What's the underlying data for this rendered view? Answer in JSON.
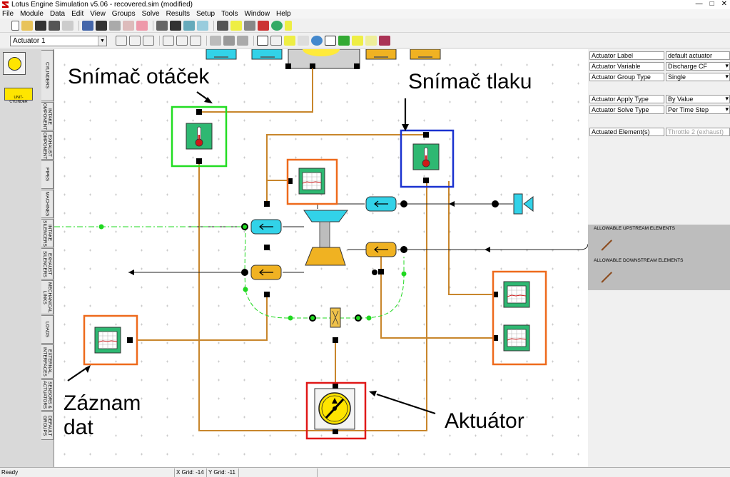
{
  "window": {
    "title": "Lotus Engine Simulation v5.06 - recovered.sim (modified)",
    "controls": [
      "—",
      "□",
      "✕"
    ]
  },
  "menu": [
    "File",
    "Module",
    "Data",
    "Edit",
    "View",
    "Groups",
    "Solve",
    "Results",
    "Setup",
    "Tools",
    "Window",
    "Help"
  ],
  "toolbar": {
    "element_select": "Actuator 1"
  },
  "left_panel": {
    "unit_cylinder_label": "UNIT-CYLINDER",
    "tabs": [
      "CYLINDERS",
      "INTAKE\nCOMPONENTS",
      "EXHAUST\nCOMPONENTS",
      "PIPES",
      "MACHINES",
      "INTAKE\nSILENCERS",
      "EXHAUST\nSILENCERS",
      "MECHANICAL\nLINKS",
      "LOADS",
      "EXTERNAL\nINTERFACES",
      "SENSORS &\nACTUATORS",
      "DEFAULT\nGROUPS"
    ]
  },
  "annotations": {
    "speed_sensor": "Snímač otáček",
    "pressure_sensor": "Snímač tlaku",
    "data_record_line1": "Záznam",
    "data_record_line2": "dat",
    "actuator": "Aktuátor"
  },
  "properties": {
    "rows": [
      {
        "label": "Actuator Label",
        "value": "default actuator",
        "dropdown": false,
        "disabled": false
      },
      {
        "label": "Actuator Variable",
        "value": "Discharge CF",
        "dropdown": true,
        "disabled": false
      },
      {
        "label": "Actuator Group Type",
        "value": "Single",
        "dropdown": true,
        "disabled": false
      },
      {
        "label": "Actuator Apply Type",
        "value": "By Value",
        "dropdown": true,
        "disabled": false
      },
      {
        "label": "Actuator Solve Type",
        "value": "Per Time Step",
        "dropdown": true,
        "disabled": false
      },
      {
        "label": "Actuated Element(s)",
        "value": "Throttle 2 (exhaust)",
        "dropdown": false,
        "disabled": true
      }
    ],
    "allowable_upstream": "ALLOWABLE UPSTREAM ELEMENTS",
    "allowable_downstream": "ALLOWABLE DOWNSTREAM ELEMENTS"
  },
  "status": {
    "state": "Ready",
    "x_grid": "X Grid: -14",
    "y_grid": "Y Grid: -11"
  },
  "colors": {
    "pipe_orange": "#c8862c",
    "signal_green": "#20d820",
    "sensor_green": "#2eb872",
    "box_green": "#22dd22",
    "box_blue": "#1a32d0",
    "box_orange": "#ee6a1c",
    "box_red": "#e01818",
    "cyan": "#32d2e8",
    "yellow_component": "#f0b222"
  }
}
